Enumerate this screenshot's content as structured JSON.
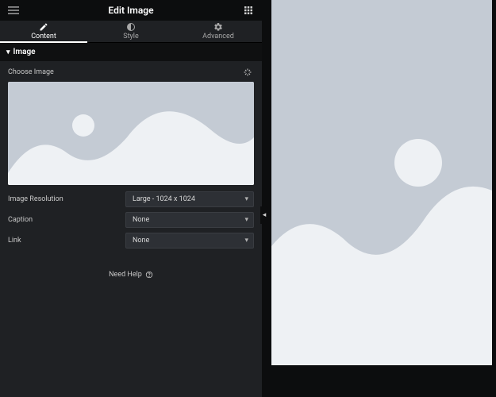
{
  "header": {
    "title": "Edit Image"
  },
  "tabs": {
    "content": "Content",
    "style": "Style",
    "advanced": "Advanced"
  },
  "section": {
    "title": "Image"
  },
  "fields": {
    "choose_image_label": "Choose Image",
    "resolution_label": "Image Resolution",
    "resolution_value": "Large - 1024 x 1024",
    "caption_label": "Caption",
    "caption_value": "None",
    "link_label": "Link",
    "link_value": "None"
  },
  "help": {
    "label": "Need Help"
  },
  "colors": {
    "placeholder_bg": "#c4cbd4",
    "placeholder_shape": "#eef1f4"
  }
}
